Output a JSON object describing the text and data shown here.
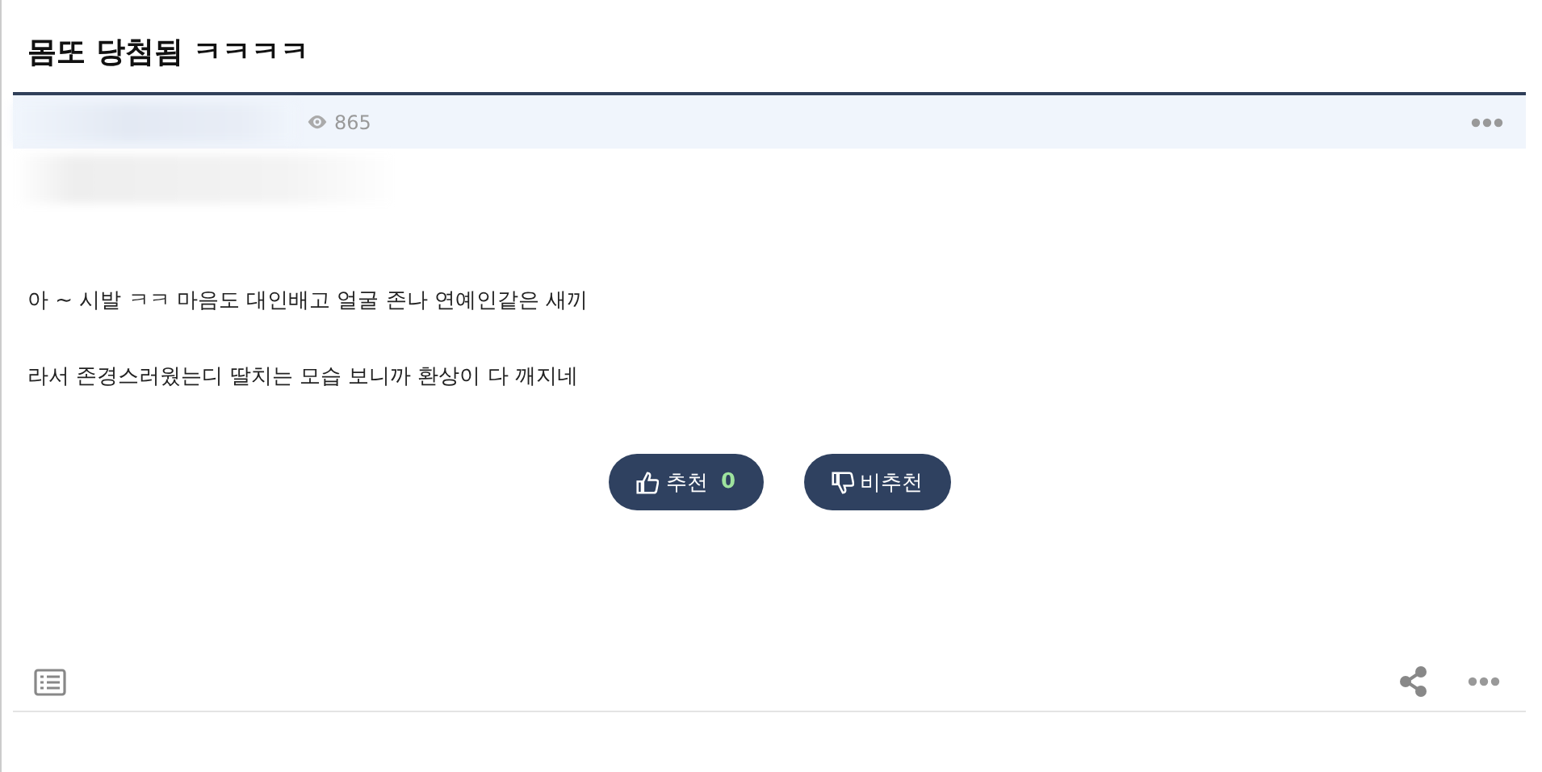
{
  "title": "몸또 당첨됨 ㅋㅋㅋㅋ",
  "views": "865",
  "body": [
    "아 ~ 시발 ㅋㅋ 마음도 대인배고 얼굴 존나 연예인같은 새끼",
    "라서 존경스러웠는디 딸치는 모습 보니까 환상이 다 깨지네"
  ],
  "upvote": {
    "label": "추천",
    "count": "0"
  },
  "downvote": {
    "label": "비추천"
  }
}
